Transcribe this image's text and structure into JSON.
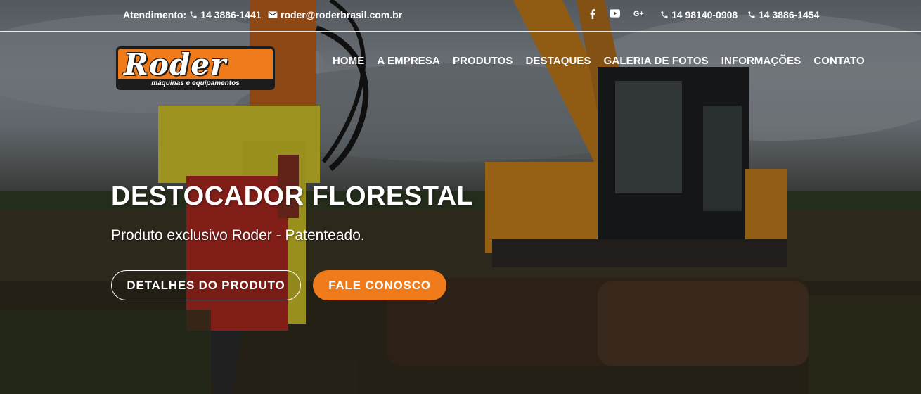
{
  "topbar": {
    "attendance_label": "Atendimento:",
    "attendance_phone": "14 3886-1441",
    "email": "roder@roderbrasil.com.br",
    "social": [
      "facebook-icon",
      "youtube-icon",
      "google-plus-icon"
    ],
    "phone_2": "14 98140-0908",
    "phone_3": "14 3886-1454"
  },
  "logo": {
    "word": "Roder",
    "tagline": "máquinas e equipamentos"
  },
  "nav": {
    "items": [
      "HOME",
      "A EMPRESA",
      "PRODUTOS",
      "DESTAQUES",
      "GALERIA DE FOTOS",
      "INFORMAÇÕES",
      "CONTATO"
    ]
  },
  "hero": {
    "title": "DESTOCADOR FLORESTAL",
    "subtitle": "Produto exclusivo Roder - Patenteado.",
    "primary_button": "DETALHES DO PRODUTO",
    "secondary_button": "FALE CONOSCO"
  },
  "colors": {
    "accent": "#f07b1b",
    "text": "#ffffff"
  }
}
